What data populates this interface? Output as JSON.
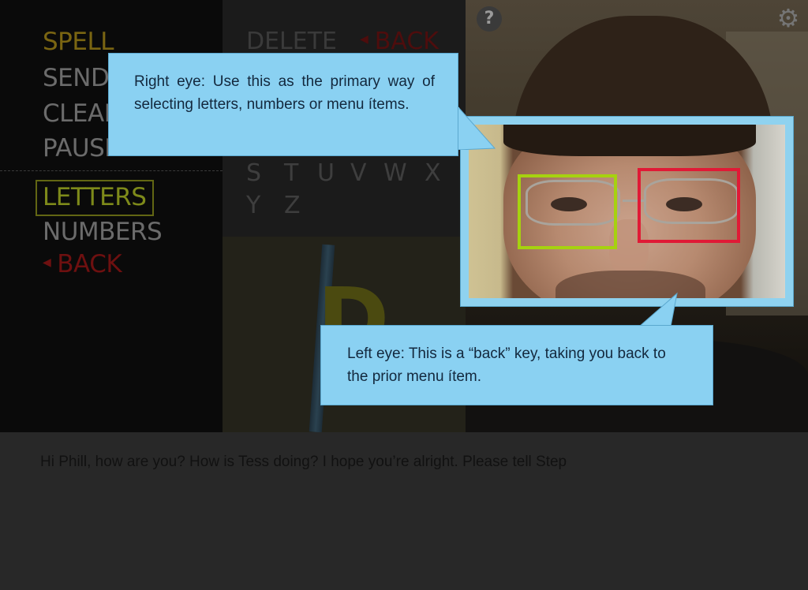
{
  "menu": {
    "items": [
      {
        "label": "SPELL"
      },
      {
        "label": "SEND"
      },
      {
        "label": "CLEAR"
      },
      {
        "label": "PAUSE"
      }
    ],
    "modes": [
      {
        "label": "LETTERS"
      },
      {
        "label": "NUMBERS"
      }
    ],
    "back_label": "BACK"
  },
  "letter_panel": {
    "delete_label": "DELETE",
    "back_label": "BACK",
    "letters_row1": [
      "S",
      "T",
      "U",
      "V",
      "W",
      "X"
    ],
    "letters_row2": [
      "Y",
      "Z"
    ],
    "current_letter": "D"
  },
  "icons": {
    "help": "question-icon",
    "settings": "gear-icon",
    "back_marker": "triangle-left-icon"
  },
  "callouts": {
    "right_eye": "Right eye: Use this as the primary way of selecting letters, numbers or menu ítems.",
    "left_eye": "Left eye: This is a “back” key, taking you back to the prior menu ítem."
  },
  "composed_text": "Hi Phill, how are you? How is Tess doing? I hope you’re alright. Please tell Step",
  "colors": {
    "right_eye_box": "#a6d20f",
    "left_eye_box": "#e01a36",
    "callout_bg": "#8ad1f2",
    "spell_highlight": "#7a6512",
    "back_red": "#6e1010"
  }
}
